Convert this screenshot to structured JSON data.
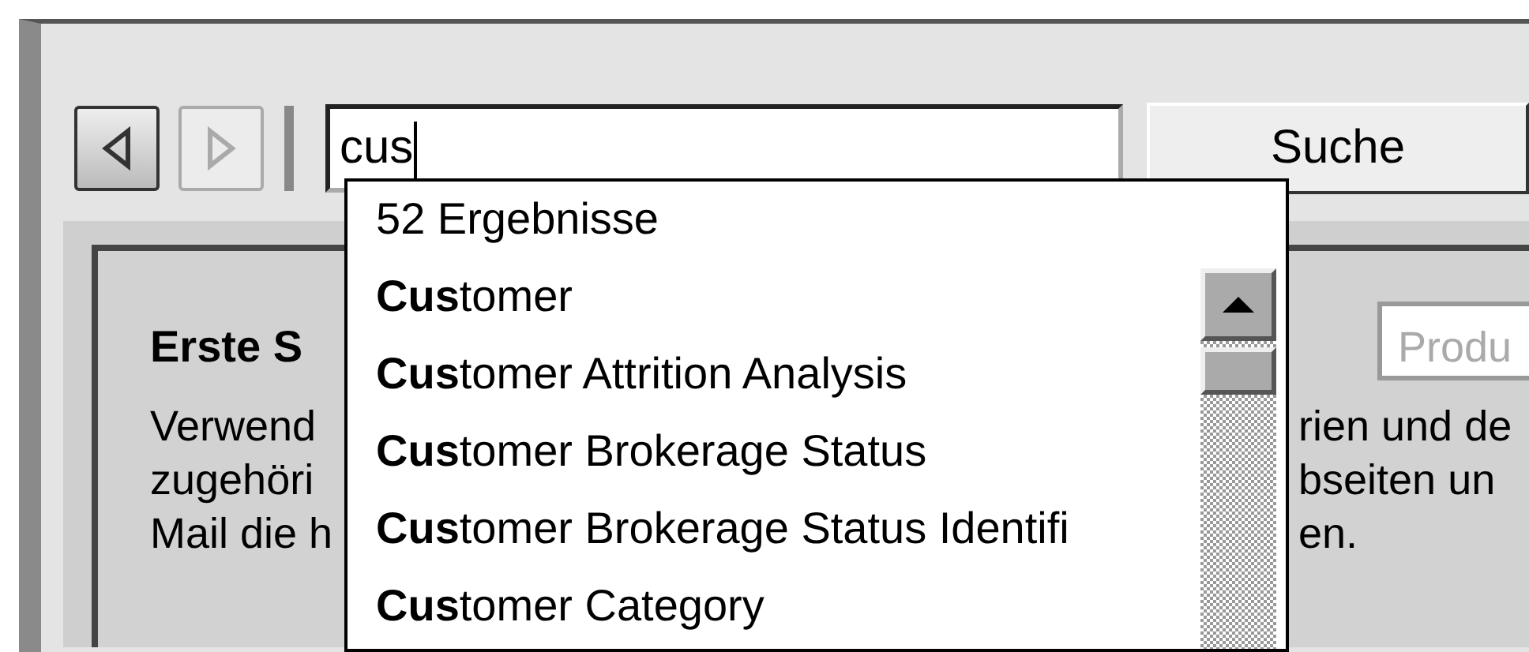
{
  "toolbar": {
    "back": {
      "disabled": false
    },
    "forward": {
      "disabled": true
    },
    "search": {
      "value": "cus"
    },
    "search_button": "Suche"
  },
  "panel": {
    "heading": "Erste S",
    "product_field": {
      "placeholder": "Produ"
    },
    "lines": [
      {
        "left": "Verwend",
        "right": "rien und de"
      },
      {
        "left": "zugehöri",
        "right": "bseiten un"
      },
      {
        "left": "Mail die h",
        "right": "en."
      }
    ]
  },
  "dropdown": {
    "count": "52 Ergebnisse",
    "items": [
      "**Cus**tomer",
      "**Cus**tomer Attrition Analysis",
      "**Cus**tomer Brokerage Status",
      "**Cus**tomer Brokerage Status Identifi",
      "**Cus**tomer Category"
    ]
  }
}
